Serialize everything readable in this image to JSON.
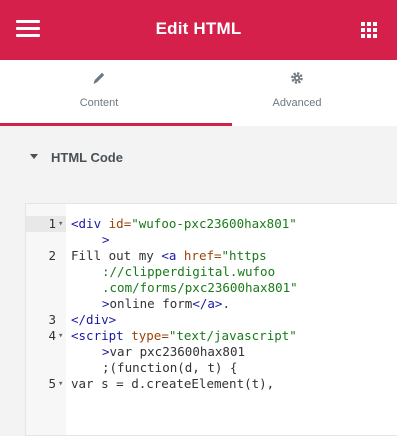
{
  "header": {
    "title": "Edit HTML",
    "menu_icon": "hamburger-menu-icon",
    "apps_icon": "grid-apps-icon",
    "bg_color": "#d4204b"
  },
  "tabs": [
    {
      "label": "Content",
      "icon": "pencil-icon",
      "active": true
    },
    {
      "label": "Advanced",
      "icon": "gear-icon",
      "active": false
    }
  ],
  "section": {
    "label": "HTML Code",
    "expanded": true
  },
  "code": {
    "lines": [
      {
        "n": "1",
        "fold": true,
        "segs": [
          [
            "tag",
            "<div "
          ],
          [
            "attr",
            "id="
          ],
          [
            "str",
            "\"wufoo-pxc23600hax801\""
          ]
        ]
      },
      {
        "n": "",
        "fold": false,
        "wrap": true,
        "segs": [
          [
            "tag",
            ">"
          ]
        ]
      },
      {
        "n": "2",
        "fold": false,
        "segs": [
          [
            "text",
            "Fill out my "
          ],
          [
            "tag",
            "<a "
          ],
          [
            "attr",
            "href="
          ],
          [
            "str",
            "\"https"
          ]
        ]
      },
      {
        "n": "",
        "fold": false,
        "wrap": true,
        "segs": [
          [
            "str",
            "://clipperdigital.wufoo"
          ]
        ]
      },
      {
        "n": "",
        "fold": false,
        "wrap": true,
        "segs": [
          [
            "str",
            ".com/forms/pxc23600hax801\""
          ]
        ]
      },
      {
        "n": "",
        "fold": false,
        "wrap": true,
        "segs": [
          [
            "tag",
            ">"
          ],
          [
            "text",
            "online form"
          ],
          [
            "tag",
            "</a>"
          ],
          [
            "text",
            "."
          ]
        ]
      },
      {
        "n": "3",
        "fold": false,
        "segs": [
          [
            "tag",
            "</div>"
          ]
        ]
      },
      {
        "n": "4",
        "fold": true,
        "segs": [
          [
            "tag",
            "<script "
          ],
          [
            "attr",
            "type="
          ],
          [
            "str",
            "\"text/javascript\""
          ]
        ]
      },
      {
        "n": "",
        "fold": false,
        "wrap": true,
        "segs": [
          [
            "tag",
            ">"
          ],
          [
            "text",
            "var pxc23600hax801"
          ]
        ]
      },
      {
        "n": "",
        "fold": false,
        "wrap": true,
        "segs": [
          [
            "text",
            ";(function(d, t) {"
          ]
        ]
      },
      {
        "n": "5",
        "fold": true,
        "segs": [
          [
            "text",
            "var s = d.createElement(t),"
          ]
        ]
      }
    ]
  }
}
